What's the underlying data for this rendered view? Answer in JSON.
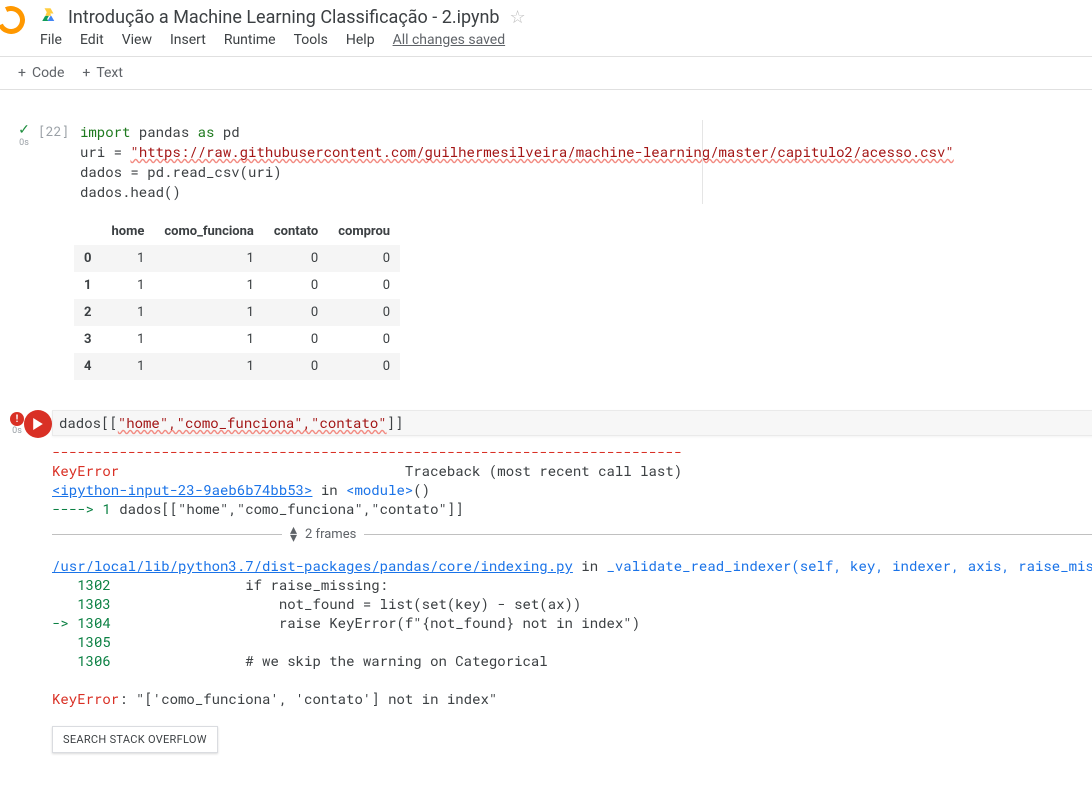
{
  "header": {
    "title": "Introdução a Machine Learning Classificação - 2.ipynb",
    "menu": {
      "file": "File",
      "edit": "Edit",
      "view": "View",
      "insert": "Insert",
      "runtime": "Runtime",
      "tools": "Tools",
      "help": "Help"
    },
    "save_status": "All changes saved"
  },
  "toolbar": {
    "code": "Code",
    "text": "Text"
  },
  "cell1": {
    "status_time": "0s",
    "prompt": "[22]",
    "code": {
      "l1a": "import",
      "l1b": " pandas ",
      "l1c": "as",
      "l1d": " pd",
      "l2a": "uri = ",
      "l2b": "\"https://raw.githubusercontent.com/guilhermesilveira/machine-learning/master/capitulo2/acesso.csv\"",
      "l3": "dados = pd.read_csv(uri)",
      "l4": "dados.head()"
    },
    "table": {
      "cols": [
        "home",
        "como_funciona",
        "contato",
        "comprou"
      ],
      "idx": [
        "0",
        "1",
        "2",
        "3",
        "4"
      ],
      "rows": [
        [
          "1",
          "1",
          "0",
          "0"
        ],
        [
          "1",
          "1",
          "0",
          "0"
        ],
        [
          "1",
          "1",
          "0",
          "0"
        ],
        [
          "1",
          "1",
          "0",
          "0"
        ],
        [
          "1",
          "1",
          "0",
          "0"
        ]
      ]
    }
  },
  "cell2": {
    "status_time": "0s",
    "code_pre": "dados[[",
    "code_str": "\"home\",\"como_funciona\",\"contato\"",
    "code_post": "]]",
    "sep": "---------------------------------------------------------------------------",
    "err_name": "KeyError",
    "tb_label": "Traceback (most recent call last)",
    "ip_link": "<ipython-input-23-9aeb6b74bb53>",
    "in_word": " in ",
    "module": "<module>",
    "module_paren": "()",
    "arrow_line": "----> 1 dados[[\"home\",\"como_funciona\",\"contato\"]]",
    "arrow_pre": "----> 1",
    "arrow_rest": " dados[[\"home\",\"como_funciona\",\"contato\"]]",
    "frames_label": "2 frames",
    "file_link": "/usr/local/lib/python3.7/dist-packages/pandas/core/indexing.py",
    "func": "_validate_read_indexer",
    "func_args": "(self, key, indexer, axis, raise_missing)",
    "src": {
      "n1302": "1302",
      "l1302": "                if raise_missing:",
      "n1303": "1303",
      "l1303": "                    not_found = list(set(key) - set(ax))",
      "n1304": "1304",
      "l1304a": "-> ",
      "l1304b": "                    raise KeyError(f\"{not_found} not in index\")",
      "n1305": "1305",
      "l1305": "",
      "n1306": "1306",
      "l1306": "                # we skip the warning on Categorical"
    },
    "final_err_pre": "KeyError",
    "final_err_msg": ": \"['como_funciona', 'contato'] not in index\"",
    "so_btn": "SEARCH STACK OVERFLOW"
  }
}
